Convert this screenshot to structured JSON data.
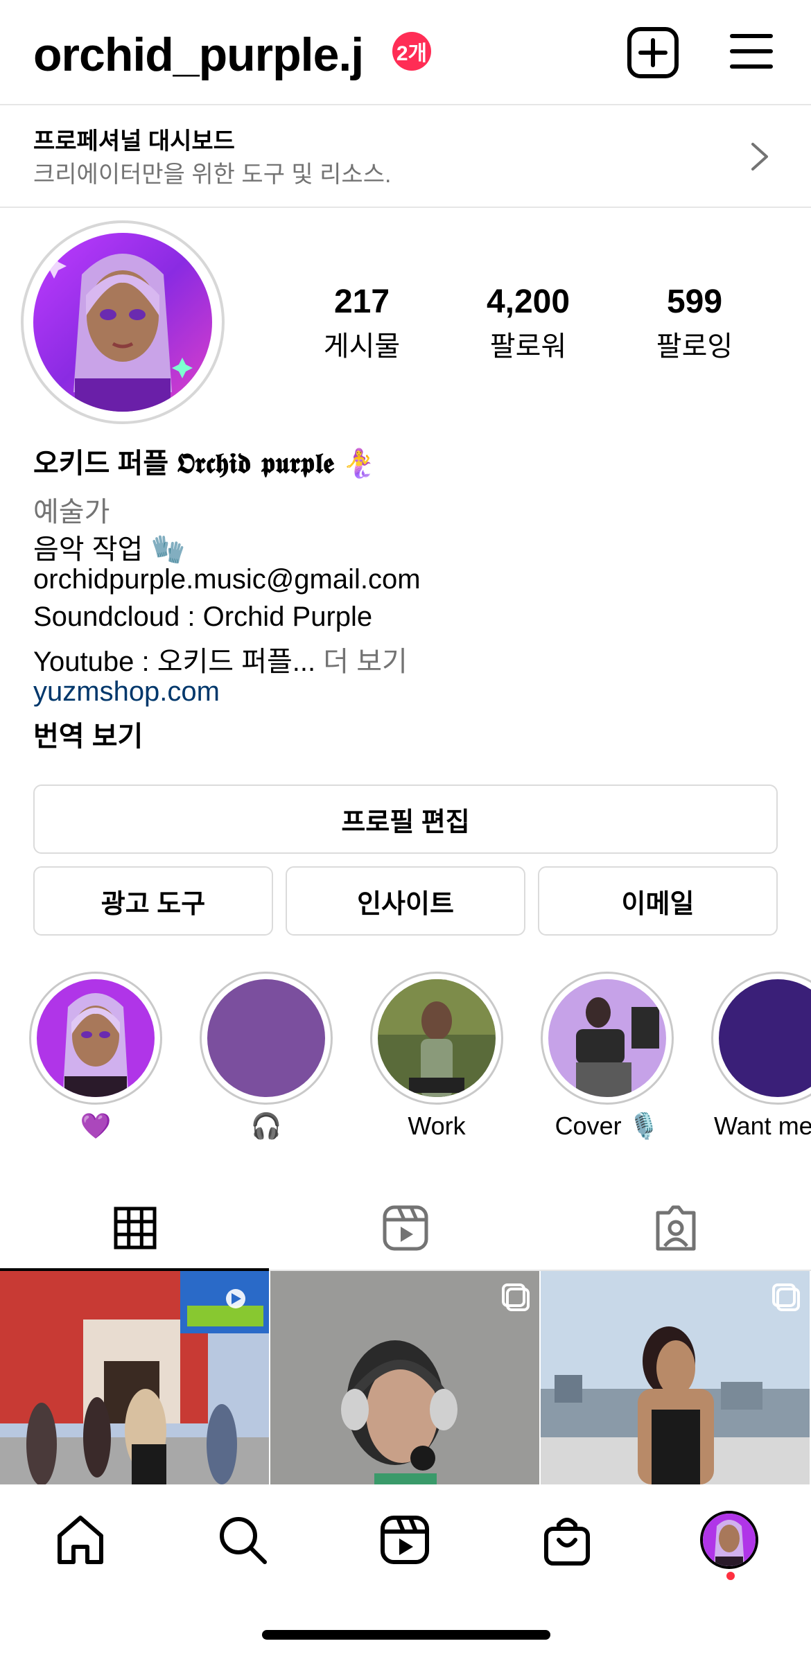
{
  "header": {
    "username": "orchid_purple.j",
    "notification_badge": "2개"
  },
  "dashboard": {
    "title": "프로페셔널 대시보드",
    "subtitle": "크리에이터만을 위한 도구 및 리소스."
  },
  "stats": {
    "posts_count": "217",
    "posts_label": "게시물",
    "followers_count": "4,200",
    "followers_label": "팔로워",
    "following_count": "599",
    "following_label": "팔로잉"
  },
  "bio": {
    "display_name": "오키드 퍼플",
    "display_name_fancy": "𝕺𝖗𝖈𝖍𝖎𝖉 𝖕𝖚𝖗𝖕𝖑𝖊",
    "name_emoji": "🧜‍♀️",
    "category": "예술가",
    "line1": "음악 작업",
    "line1_emoji": "🧤",
    "email": "orchidpurple.music@gmail.com",
    "soundcloud": "Soundcloud : Orchid Purple",
    "youtube": "Youtube : 오키드 퍼플...",
    "more": "더 보기",
    "website": "yuzmshop.com",
    "translate": "번역 보기"
  },
  "buttons": {
    "edit_profile": "프로필 편집",
    "ad_tools": "광고 도구",
    "insights": "인사이트",
    "email": "이메일"
  },
  "highlights": [
    {
      "label": "💜",
      "icon": "avatar-image"
    },
    {
      "label": "🎧",
      "icon": "solid-purple"
    },
    {
      "label": "Work",
      "icon": "photo"
    },
    {
      "label": "Cover 🎙️",
      "icon": "photo"
    },
    {
      "label": "Want me l",
      "icon": "solid-indigo"
    }
  ],
  "tabs": [
    {
      "name": "grid",
      "icon": "grid-icon",
      "active": true
    },
    {
      "name": "reels",
      "icon": "reels-icon",
      "active": false
    },
    {
      "name": "tagged",
      "icon": "tagged-icon",
      "active": false
    }
  ],
  "bottom_nav": [
    "home-icon",
    "search-icon",
    "reels-icon",
    "shop-icon",
    "profile-avatar"
  ],
  "colors": {
    "accent_red": "#ff2d55",
    "link_blue": "#00376b",
    "muted_gray": "#737373",
    "highlight_purple": "#7b4f9e",
    "highlight_indigo": "#3a1f78"
  }
}
